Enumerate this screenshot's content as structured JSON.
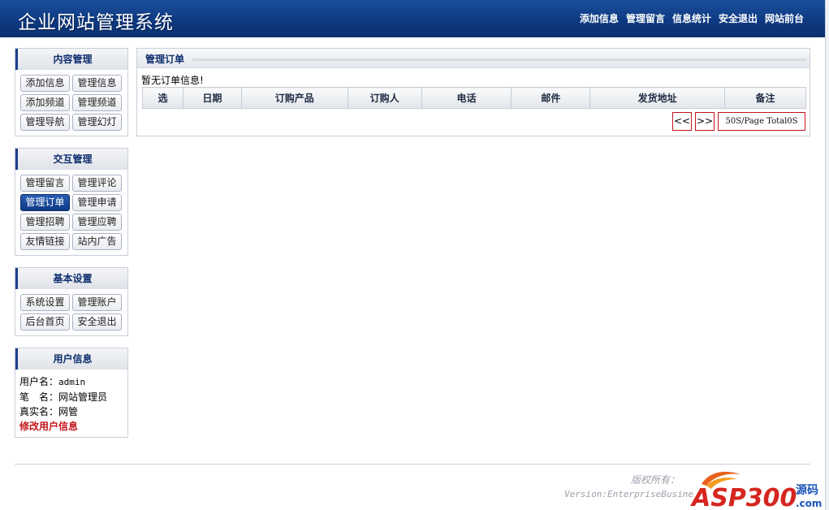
{
  "header": {
    "title": "企业网站管理系统",
    "nav": [
      "添加信息",
      "管理留言",
      "信息统计",
      "安全退出",
      "网站前台"
    ]
  },
  "sidebar": {
    "content": {
      "title": "内容管理",
      "buttons": [
        "添加信息",
        "管理信息",
        "添加频道",
        "管理频道",
        "管理导航",
        "管理幻灯"
      ]
    },
    "interact": {
      "title": "交互管理",
      "buttons": [
        "管理留言",
        "管理评论",
        "管理订单",
        "管理申请",
        "管理招聘",
        "管理应聘",
        "友情链接",
        "站内广告"
      ],
      "active_index": 2
    },
    "basic": {
      "title": "基本设置",
      "buttons": [
        "系统设置",
        "管理账户",
        "后台首页",
        "安全退出"
      ]
    },
    "user": {
      "title": "用户信息",
      "username_label": "用户名：",
      "username": "admin",
      "nickname_label": "笔　名：",
      "nickname": "网站管理员",
      "realname_label": "真实名：",
      "realname": "网管",
      "edit_link": "修改用户信息"
    }
  },
  "main": {
    "title": "管理订单",
    "notice": "暂无订单信息!",
    "columns": [
      "选",
      "日期",
      "订购产品",
      "订购人",
      "电话",
      "邮件",
      "发货地址",
      "备注"
    ],
    "pager": {
      "prev": "<<",
      "next": ">>",
      "info": "50S/Page Total0S"
    }
  },
  "footer": {
    "copyright": "版权所有：",
    "version": "Version:EnterpriseBusiness",
    "logo_text": "ASP300",
    "logo_sub": "源码",
    "logo_com": ".com"
  },
  "colors": {
    "header_bg": "#0e3a82",
    "accent_red": "#c4161c",
    "active_btn": "#1b4c9e"
  }
}
